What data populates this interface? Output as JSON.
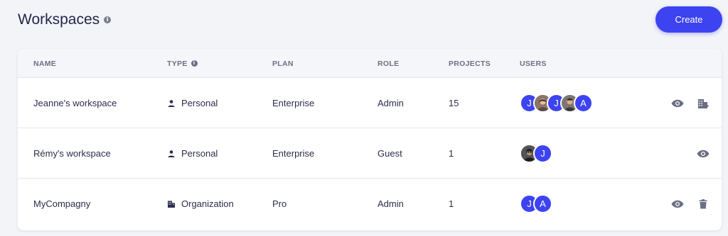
{
  "page": {
    "title": "Workspaces",
    "create_label": "Create"
  },
  "table": {
    "headers": {
      "name": "NAME",
      "type": "TYPE",
      "plan": "PLAN",
      "role": "ROLE",
      "projects": "PROJECTS",
      "users": "USERS"
    },
    "rows": [
      {
        "name": "Jeanne's workspace",
        "type": "Personal",
        "type_icon": "person-icon",
        "plan": "Enterprise",
        "role": "Admin",
        "projects": "15",
        "users": [
          "J",
          "photo-woman",
          "J",
          "photo-man",
          "A"
        ],
        "actions": [
          "view-icon",
          "building-icon"
        ]
      },
      {
        "name": "Rémy's workspace",
        "type": "Personal",
        "type_icon": "person-icon",
        "plan": "Enterprise",
        "role": "Guest",
        "projects": "1",
        "users": [
          "photo-man-glasses",
          "J"
        ],
        "actions": [
          "view-icon"
        ]
      },
      {
        "name": "MyCompagny",
        "type": "Organization",
        "type_icon": "organization-icon",
        "plan": "Pro",
        "role": "Admin",
        "projects": "1",
        "users": [
          "J",
          "A"
        ],
        "actions": [
          "view-icon",
          "delete-icon"
        ]
      }
    ]
  },
  "colors": {
    "accent": "#3d43f0",
    "background": "#f3f4f8",
    "icon": "#6b6f84"
  }
}
